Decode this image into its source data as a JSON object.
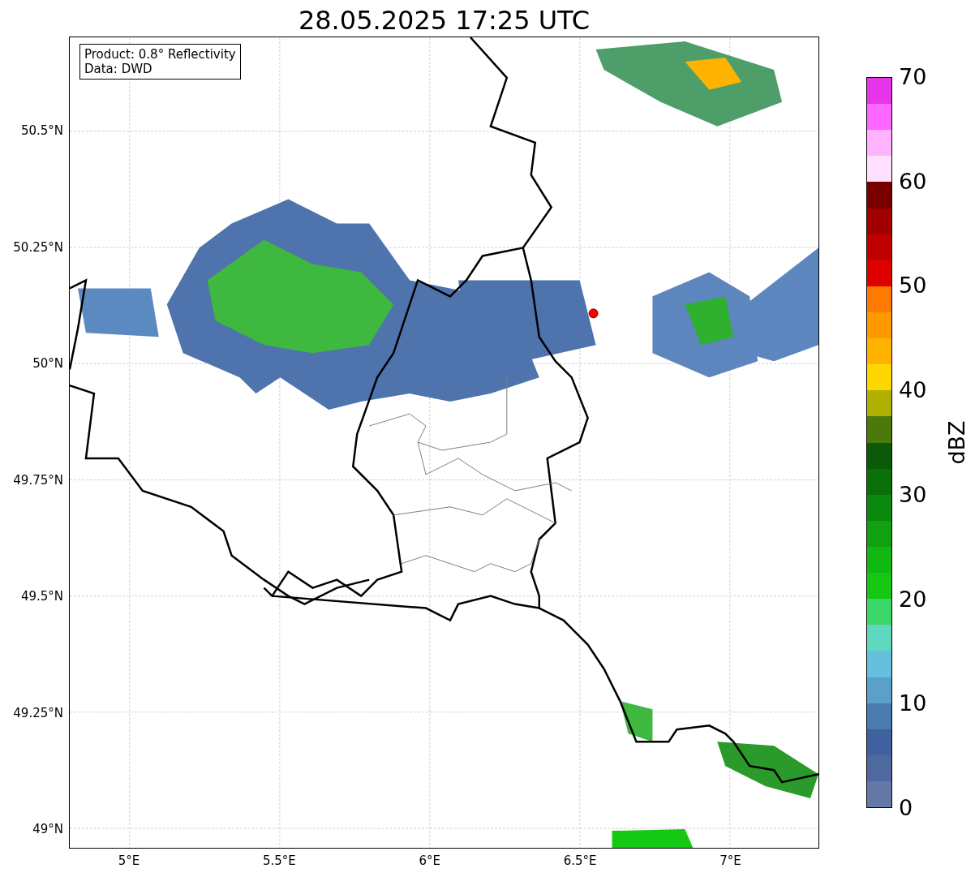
{
  "title": "28.05.2025 17:25 UTC",
  "info_box": [
    "Product: 0.8° Reflectivity",
    "Data: DWD"
  ],
  "map": {
    "yticks": [
      "50.5°N",
      "50.25°N",
      "50°N",
      "49.75°N",
      "49.5°N",
      "49.25°N",
      "49°N"
    ],
    "xticks": [
      "5°E",
      "5.5°E",
      "6°E",
      "6.5°E",
      "7°E"
    ]
  },
  "colorbar": {
    "label": "dBZ",
    "ticks": [
      "70",
      "60",
      "50",
      "40",
      "30",
      "20",
      "10",
      "0"
    ],
    "segments": [
      {
        "color": "#e935e9"
      },
      {
        "color": "#ff66ff"
      },
      {
        "color": "#ffb3ff"
      },
      {
        "color": "#ffe0ff"
      },
      {
        "color": "#7a0000"
      },
      {
        "color": "#a00000"
      },
      {
        "color": "#c00000"
      },
      {
        "color": "#e00000"
      },
      {
        "color": "#ff7a00"
      },
      {
        "color": "#ff9900"
      },
      {
        "color": "#ffb300"
      },
      {
        "color": "#ffd700"
      },
      {
        "color": "#b0b000"
      },
      {
        "color": "#4a7a0a"
      },
      {
        "color": "#0a5a0a"
      },
      {
        "color": "#0a700a"
      },
      {
        "color": "#0c880c"
      },
      {
        "color": "#10a010"
      },
      {
        "color": "#12b812"
      },
      {
        "color": "#14c814"
      },
      {
        "color": "#3dd66a"
      },
      {
        "color": "#5fd8c0"
      },
      {
        "color": "#65c0de"
      },
      {
        "color": "#5aa0c8"
      },
      {
        "color": "#4a7ab0"
      },
      {
        "color": "#4060a0"
      },
      {
        "color": "#5068a0"
      },
      {
        "color": "#6478a8"
      }
    ]
  }
}
